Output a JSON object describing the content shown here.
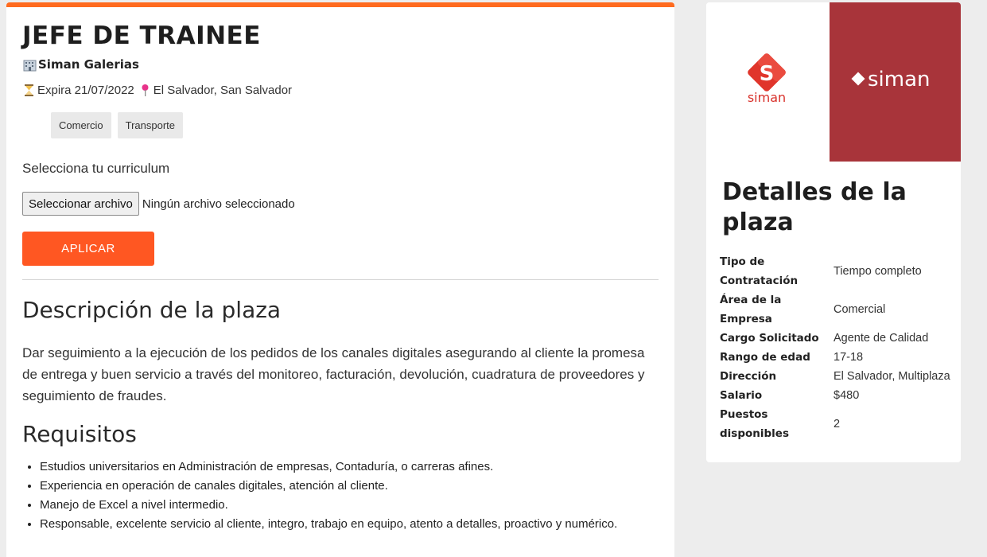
{
  "job": {
    "title": "JEFE DE TRAINEE",
    "company": "Siman Galerias",
    "expires": "Expira 21/07/2022",
    "location": "El Salvador, San Salvador",
    "tags": [
      "Comercio",
      "Transporte"
    ]
  },
  "application": {
    "cv_label": "Selecciona tu curriculum",
    "file_button": "Seleccionar archivo",
    "file_status": "Ningún archivo seleccionado",
    "apply_label": "APLICAR"
  },
  "description": {
    "heading": "Descripción de la plaza",
    "text": "Dar seguimiento a la ejecución de los pedidos de los canales digitales asegurando al cliente la promesa de entrega y buen servicio a través del monitoreo, facturación, devolución, cuadratura de proveedores y seguimiento de fraudes."
  },
  "requirements": {
    "heading": "Requisitos",
    "items": [
      "Estudios universitarios en Administración de empresas, Contaduría, o carreras afines.",
      "Experiencia en operación de canales digitales, atención al cliente.",
      "Manejo de Excel a nivel intermedio.",
      "Responsable, excelente servicio al cliente, integro, trabajo en equipo, atento a detalles, proactivo y numérico."
    ]
  },
  "sidebar": {
    "logo_small_text": "siman",
    "logo_small_letter": "S",
    "logo_large_text": "siman",
    "title": "Detalles de la plaza",
    "details": [
      {
        "key": "Tipo de Contratación",
        "value": "Tiempo completo"
      },
      {
        "key": "Área de la Empresa",
        "value": "Comercial"
      },
      {
        "key": "Cargo Solicitado",
        "value": "Agente de Calidad"
      },
      {
        "key": "Rango de edad",
        "value": "17-18"
      },
      {
        "key": "Dirección",
        "value": "El Salvador, Multiplaza"
      },
      {
        "key": "Salario",
        "value": "$480"
      },
      {
        "key": "Puestos disponibles",
        "value": "2"
      }
    ]
  },
  "colors": {
    "accent": "#ff5722",
    "top_bar": "#ff6b1f",
    "brand_red": "#a8343a"
  }
}
